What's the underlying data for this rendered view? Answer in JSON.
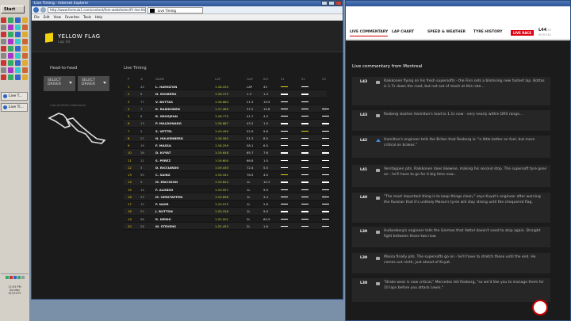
{
  "taskbar": {
    "start_label": "Start",
    "buttons": [
      "Live T...",
      "Live Ti..."
    ],
    "clock": "12:05 PM",
    "day": "Sunday",
    "date": "6/7/2015"
  },
  "browser": {
    "title": "Live Timing - Internet Explorer",
    "address": "http://www.formula1.com/content/fom-website/en/f1-live.html#",
    "tab": "Live Timing",
    "menu": [
      "File",
      "Edit",
      "View",
      "Favorites",
      "Tools",
      "Help"
    ]
  },
  "flag": {
    "title": "YELLOW FLAG",
    "lap": "Lap 44"
  },
  "h2h": {
    "title": "Head-to-head",
    "select1": [
      "SELECT",
      "DRIVER"
    ],
    "select2": [
      "SELECT",
      "DRIVER"
    ],
    "circuit": "Circuit Gilles Villeneuve"
  },
  "timing": {
    "title": "Live Timing",
    "headers": [
      "P",
      "#",
      "NAME",
      "LAP",
      "GAP",
      "INT",
      "S1",
      "S2",
      "S3"
    ],
    "rows": [
      {
        "p": "1",
        "n": "44",
        "name": "L. HAMILTON",
        "lap": "1:18.202",
        "gap": "LAP",
        "int": "43",
        "s": [
          "y",
          "w",
          ""
        ]
      },
      {
        "p": "2",
        "n": "6",
        "name": "N. ROSBERG",
        "lap": "1:18.375",
        "gap": "1.3",
        "int": "1.3",
        "s": [
          "w",
          "w",
          ""
        ]
      },
      {
        "p": "3",
        "n": "77",
        "name": "V. BOTTAS",
        "lap": "1:18.684",
        "gap": "21.3",
        "int": "19.9",
        "s": [
          "w",
          "w",
          ""
        ]
      },
      {
        "p": "4",
        "n": "7",
        "name": "K. RAIKKONEN",
        "lap": "1:17.465",
        "gap": "37.2",
        "int": "15.8",
        "s": [
          "w",
          "w",
          "w"
        ]
      },
      {
        "p": "5",
        "n": "8",
        "name": "R. GROSJEAN",
        "lap": "1:18.770",
        "gap": "41.7",
        "int": "4.5",
        "s": [
          "w",
          "w",
          "w"
        ]
      },
      {
        "p": "6",
        "n": "13",
        "name": "P. MALDONADO",
        "lap": "1:18.687",
        "gap": "43.2",
        "int": "1.5",
        "s": [
          "w",
          "w",
          "w"
        ]
      },
      {
        "p": "7",
        "n": "5",
        "name": "S. VETTEL",
        "lap": "1:19.499",
        "gap": "52.9",
        "int": "9.6",
        "s": [
          "w",
          "y",
          "w"
        ]
      },
      {
        "p": "8",
        "n": "27",
        "name": "N. HULKENBERG",
        "lap": "1:18.562",
        "gap": "51.3",
        "int": "8.5",
        "s": [
          "w",
          "w",
          "w"
        ]
      },
      {
        "p": "9",
        "n": "19",
        "name": "F. MASSA",
        "lap": "1:18.259",
        "gap": "58.1",
        "int": "6.5",
        "s": [
          "w",
          "w",
          "w"
        ]
      },
      {
        "p": "10",
        "n": "26",
        "name": "D. KVYAT",
        "lap": "1:19.648",
        "gap": "65.7",
        "int": "7.6",
        "s": [
          "w",
          "w",
          "w"
        ]
      },
      {
        "p": "11",
        "n": "11",
        "name": "S. PEREZ",
        "lap": "1:19.600",
        "gap": "66.8",
        "int": "1.0",
        "s": [
          "w",
          "w",
          "w"
        ]
      },
      {
        "p": "12",
        "n": "3",
        "name": "D. RICCIARDO",
        "lap": "1:19.430",
        "gap": "72.4",
        "int": "5.5",
        "s": [
          "w",
          "w",
          "w"
        ]
      },
      {
        "p": "13",
        "n": "55",
        "name": "C. SAINZ",
        "lap": "1:19.341",
        "gap": "76.5",
        "int": "4.0",
        "s": [
          "y",
          "w",
          "w"
        ]
      },
      {
        "p": "14",
        "n": "9",
        "name": "M. ERICSSON",
        "lap": "1:19.824",
        "gap": "1L",
        "int": "10.3",
        "s": [
          "w",
          "w",
          "w"
        ]
      },
      {
        "p": "15",
        "n": "14",
        "name": "F. ALONSO",
        "lap": "1:19.957",
        "gap": "1L",
        "int": "9.9",
        "s": [
          "w",
          "w",
          "w"
        ]
      },
      {
        "p": "16",
        "n": "33",
        "name": "M. VERSTAPPEN",
        "lap": "1:19.696",
        "gap": "1L",
        "int": "3.4",
        "s": [
          "w",
          "w",
          "w"
        ]
      },
      {
        "p": "17",
        "n": "12",
        "name": "F. NASR",
        "lap": "1:19.975",
        "gap": "1L",
        "int": "2.6",
        "s": [
          "w",
          "w",
          "w"
        ]
      },
      {
        "p": "18",
        "n": "22",
        "name": "J. BUTTON",
        "lap": "1:20.258",
        "gap": "1L",
        "int": "9.9",
        "s": [
          "w",
          "w",
          "w"
        ]
      },
      {
        "p": "19",
        "n": "98",
        "name": "R. MERHI",
        "lap": "1:22.001",
        "gap": "2L",
        "int": "64.9",
        "s": [
          "w",
          "w",
          "w"
        ]
      },
      {
        "p": "20",
        "n": "28",
        "name": "W. STEVENS",
        "lap": "1:22.453",
        "gap": "2L",
        "int": "1.6",
        "s": [
          "w",
          "w",
          "w"
        ]
      }
    ]
  },
  "commentary": {
    "tabs": [
      "LIVE COMMENTARY",
      "LAP CHART",
      "SPEED & WEATHER",
      "TYRE HISTORY"
    ],
    "live": "LIVE RACE",
    "lap": "L44",
    "lap_total": "/70",
    "time": "00:57:42",
    "title": "Live commentary from Montreal",
    "items": [
      {
        "lap": "L43",
        "icon": "chat",
        "text": "Raikkonen flying on his fresh supersofts - the Finn sets a blistering new fastest lap. Bottas is 1.7s down the road, but not out of reach at this rate..."
      },
      {
        "lap": "L43",
        "icon": "chat",
        "text": "Rosberg slashes Hamilton's lead to 1.1s now - very nearly within DRS range..."
      },
      {
        "lap": "L42",
        "icon": "up",
        "text": "Hamilton's engineer tells the Briton that Rosberg is: \"a little better on fuel, but more critical on brakes.\""
      },
      {
        "lap": "L41",
        "icon": "chat",
        "text": "Verstappen pits. Raikkonen does likewise, making his second stop. The supersoft tyre goes on - he'll have to go for it big time now..."
      },
      {
        "lap": "L40",
        "icon": "chat",
        "text": "\"The most important thing is to keep things clean,\" says Kvyat's engineer after warning the Russian that it's unlikely Massa's tyres will stay strong until the chequered flag."
      },
      {
        "lap": "L39",
        "icon": "chat",
        "text": "Hulkenberg's engineer tells the German that Vettel doesn't need to stop again. Straight fight between those two now."
      },
      {
        "lap": "L39",
        "icon": "chat",
        "text": "Massa finally pits. The supersofts go on - he'll have to stretch these until the end. He comes out ninth, just ahead of Kvyat."
      },
      {
        "lap": "L38",
        "icon": "chat",
        "text": "\"Brake wear is now critical,\" Mercedes tell Rosberg, \"so we'd like you to manage them for 10 laps before you attack Lewis.\""
      }
    ]
  }
}
